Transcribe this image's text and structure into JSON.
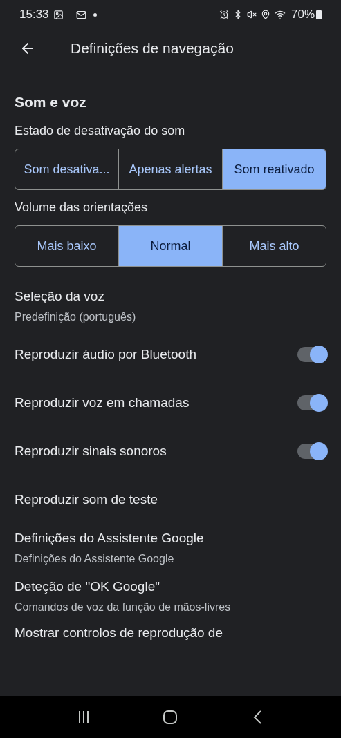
{
  "status_bar": {
    "time": "15:33",
    "battery": "70%"
  },
  "header": {
    "title": "Definições de navegação"
  },
  "section": {
    "title": "Som e voz"
  },
  "segments": [
    {
      "label": "Estado de desativação do som",
      "options": [
        {
          "label": "Som desativa...",
          "selected": false
        },
        {
          "label": "Apenas alertas",
          "selected": false
        },
        {
          "label": "Som reativado",
          "selected": true
        }
      ]
    },
    {
      "label": "Volume das orientações",
      "options": [
        {
          "label": "Mais baixo",
          "selected": false
        },
        {
          "label": "Normal",
          "selected": true
        },
        {
          "label": "Mais alto",
          "selected": false
        }
      ]
    }
  ],
  "items": [
    {
      "kind": "text",
      "title": "Seleção da voz",
      "subtitle": "Predefinição (português)"
    },
    {
      "kind": "toggle",
      "title": "Reproduzir áudio por Bluetooth",
      "on": true
    },
    {
      "kind": "toggle",
      "title": "Reproduzir voz em chamadas",
      "on": true
    },
    {
      "kind": "toggle",
      "title": "Reproduzir sinais sonoros",
      "on": true
    },
    {
      "kind": "text",
      "title": "Reproduzir som de teste"
    },
    {
      "kind": "text",
      "title": "Definições do Assistente Google",
      "subtitle": "Definições do Assistente Google"
    },
    {
      "kind": "text",
      "title": "Deteção de \"OK Google\"",
      "subtitle": "Comandos de voz da função de mãos-livres"
    }
  ],
  "cut_item": {
    "title": "Mostrar controlos de reprodução de"
  }
}
